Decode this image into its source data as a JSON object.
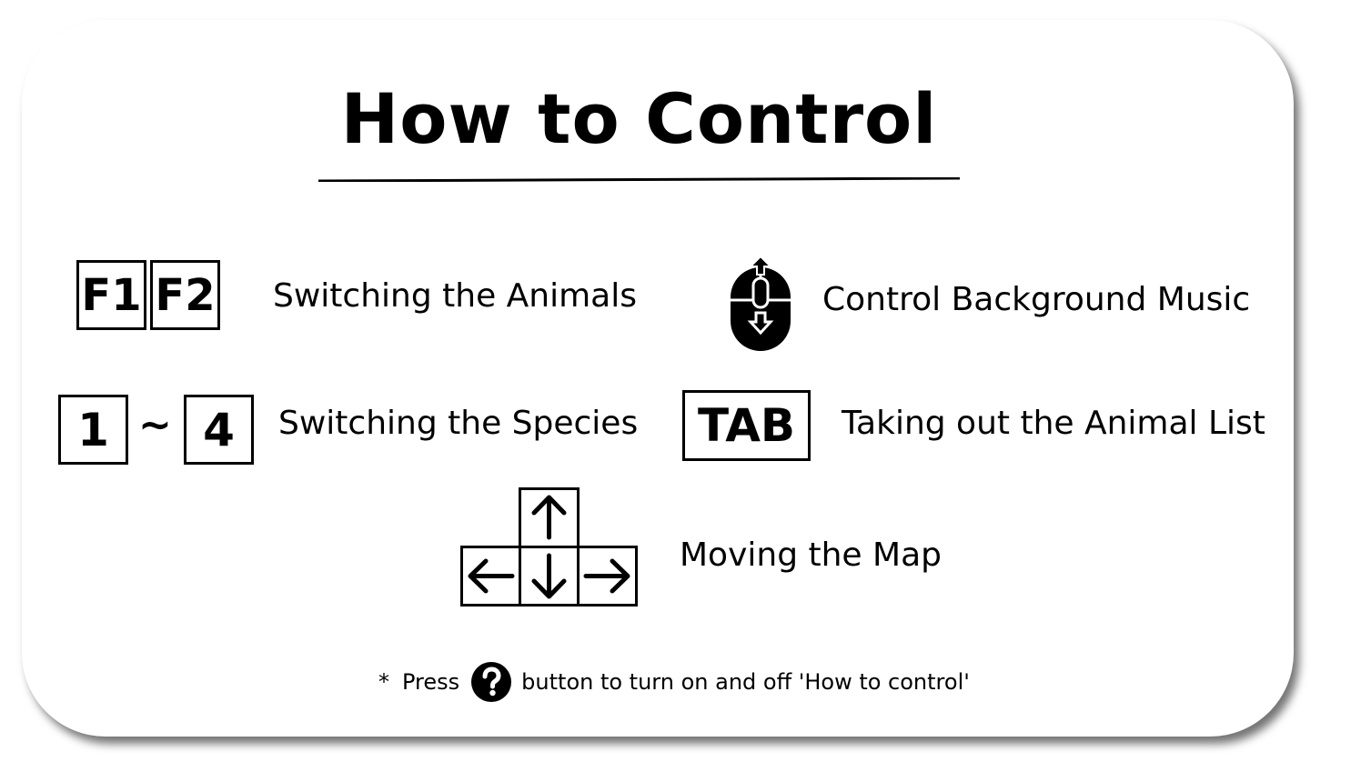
{
  "title": "How to Control",
  "controls": {
    "animals": {
      "keys": [
        "F1",
        "F2"
      ],
      "label": "Switching the Animals"
    },
    "species": {
      "key_from": "1",
      "separator": "~",
      "key_to": "4",
      "label": "Switching the Species"
    },
    "music": {
      "icon": "mouse-scroll-icon",
      "label": "Control Background Music"
    },
    "list": {
      "key": "TAB",
      "label": "Taking out the Animal List"
    },
    "map": {
      "icons": [
        "arrow-up-icon",
        "arrow-left-icon",
        "arrow-down-icon",
        "arrow-right-icon"
      ],
      "label": "Moving the Map"
    }
  },
  "footer": {
    "asterisk": "*",
    "press": "Press",
    "icon": "question-circle-icon",
    "rest": "button to turn on and off 'How to control'"
  }
}
